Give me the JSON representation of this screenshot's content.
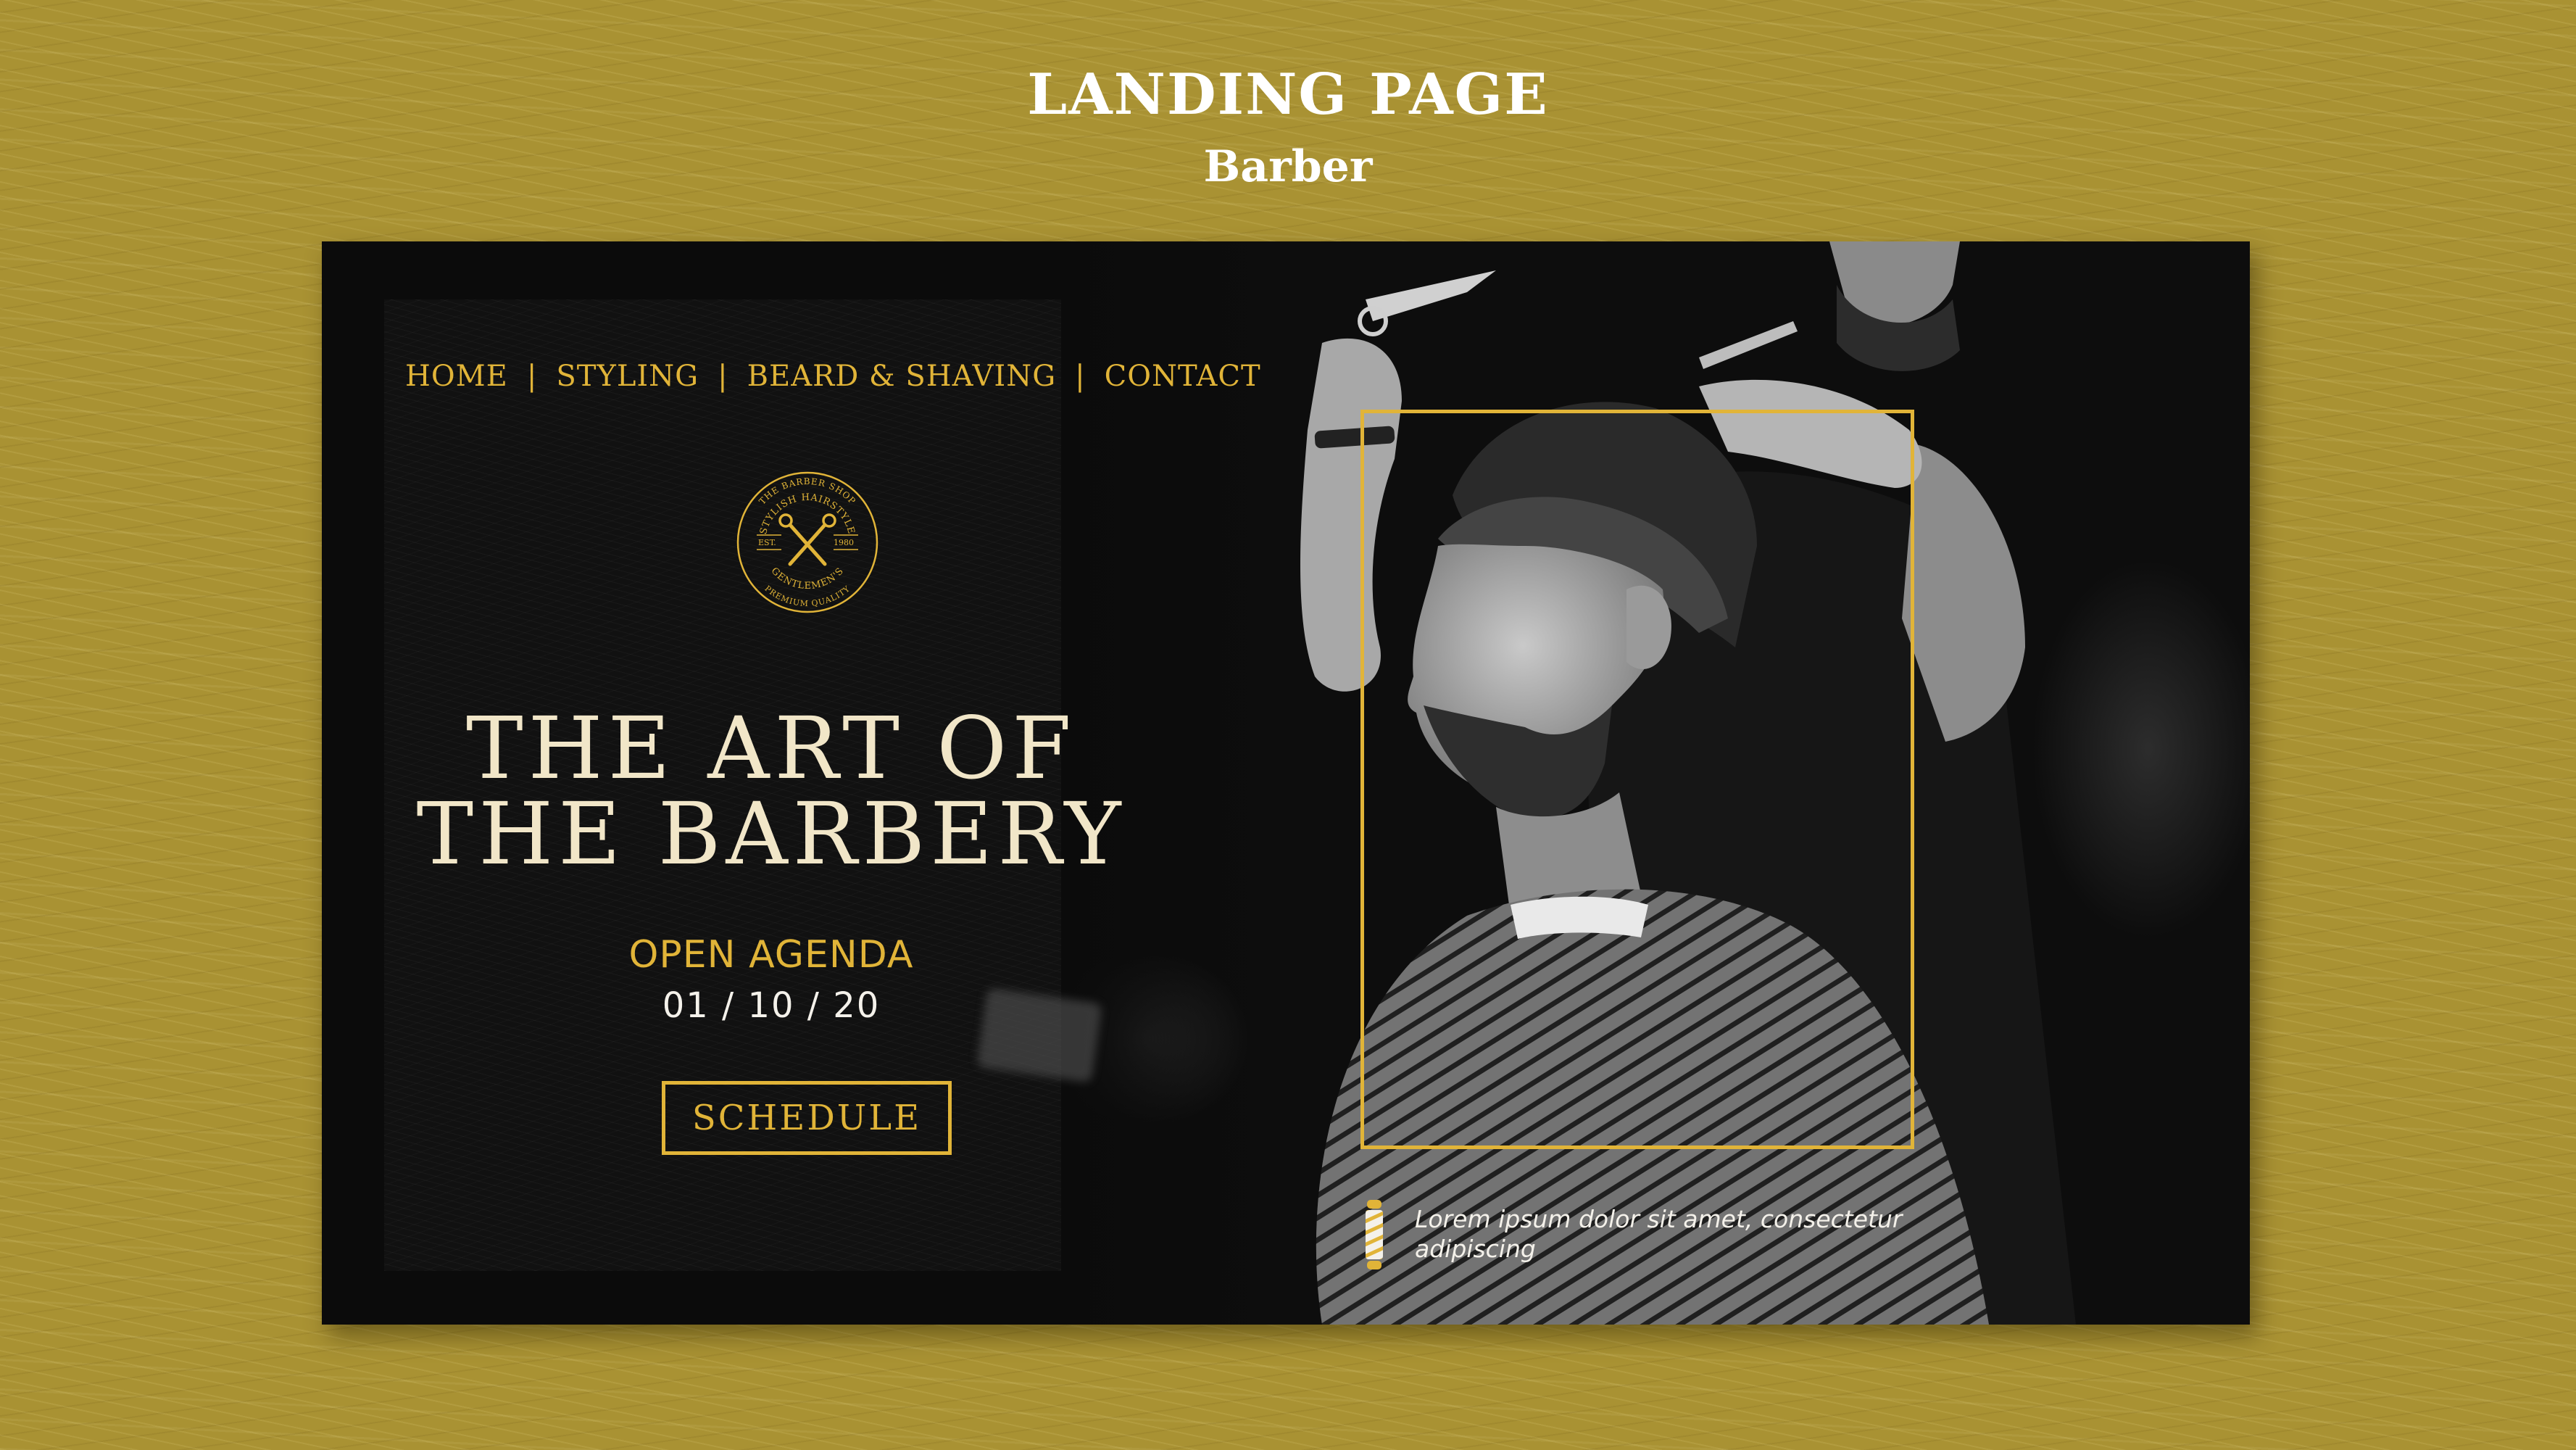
{
  "header": {
    "title": "LANDING PAGE",
    "subtitle": "Barber"
  },
  "nav": {
    "items": [
      {
        "label": "HOME"
      },
      {
        "label": "STYLING"
      },
      {
        "label": "BEARD & SHAVING"
      },
      {
        "label": "CONTACT"
      }
    ],
    "separator": "|"
  },
  "emblem": {
    "top_arc": "THE BARBER SHOP",
    "inner_arc": "STYLISH HAIRSTYLE",
    "left_text": "EST.",
    "right_text": "1980",
    "bottom_inner_arc": "GENTLEMEN'S",
    "bottom_arc": "PREMIUM QUALITY"
  },
  "hero": {
    "line1": "THE ART OF",
    "line2": "THE BARBERY"
  },
  "agenda": {
    "label": "OPEN AGENDA",
    "date": "01 / 10 / 20"
  },
  "cta": {
    "label": "SCHEDULE"
  },
  "caption": {
    "text": "Lorem ipsum dolor sit amet, consectetur adipiscing"
  },
  "icons": {
    "emblem": "scissors-emblem-icon",
    "pole": "barber-pole-icon"
  },
  "colors": {
    "background": "#a99233",
    "panel": "#0b0b0b",
    "accent": "#e1b438",
    "title": "#f1e6c8",
    "text_light": "#f4f1ea"
  }
}
